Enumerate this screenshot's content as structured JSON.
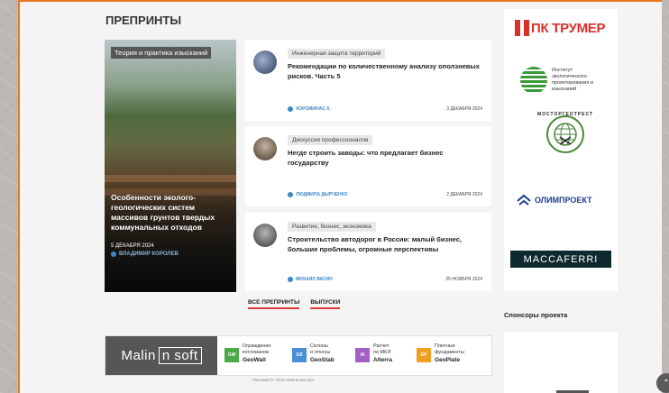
{
  "section": {
    "title": "ПРЕПРИНТЫ"
  },
  "featured": {
    "tag": "Теория и практика изысканий",
    "title": "Особенности эколого-геологических систем массивов грунтов твердых коммунальных отходов",
    "date": "5 ДЕКАБРЯ 2024",
    "author": "ВЛАДИМИР КОРОЛЕВ"
  },
  "articles": [
    {
      "tag": "Инженерная защита территорий",
      "title": "Рекомендации по количественному анализу оползневых рисков. Часть 5",
      "author": "ХОРОМИНАС Х.",
      "date": "3 ДЕКАБРЯ 2024",
      "thumb_color": "#5a6b8a"
    },
    {
      "tag": "Дискуссия профессионалов",
      "title": "Негде строить заводы: что предлагает бизнес государству",
      "author": "ЛЮДМИЛА ДЫРЧЕНКО",
      "date": "2 ДЕКАБРЯ 2024",
      "thumb_color": "#7a6a5a"
    },
    {
      "tag": "Развитие, бизнес, экономика",
      "title": "Строительство автодорог в России: малый бизнес, большие проблемы, огромные перспективы",
      "author": "МИХАИЛ ВАСИН",
      "date": "25 НОЯБРЯ 2024",
      "thumb_color": "#6a6a6a"
    }
  ],
  "links": {
    "all_preprints": "ВСЕ ПРЕПРИНТЫ",
    "issues": "ВЫПУСКИ"
  },
  "banner": {
    "brand_left": "Malin",
    "brand_right": "n soft",
    "products": [
      {
        "code": "GW",
        "line1": "Ограждение",
        "line2": "котлованов",
        "name": "GeoWall",
        "color": "#4aaa44"
      },
      {
        "code": "GS",
        "line1": "Склоны",
        "line2": "и откосы",
        "name": "GeoStab",
        "color": "#4a8fd6"
      },
      {
        "code": "AI",
        "line1": "Расчет",
        "line2": "по МКЭ",
        "name": "Alterra",
        "color": "#a25fc4"
      },
      {
        "code": "GP",
        "line1": "Плитные",
        "line2": "фундаменты",
        "name": "GeoPlate",
        "color": "#f0a020"
      }
    ],
    "ad_note": "Реклама 0+ ООО Инжгеоэксперт"
  },
  "sidebar": {
    "trumer": "ПК ТРУМЕР",
    "institute": "Институт экологического проектирования и изысканий",
    "mosto": "МОСТОРГЕОТРЕСТ",
    "olimp": "ОЛИМПРОЕКТ",
    "maccaferri": "MACCAFERRI"
  },
  "sponsors": {
    "title": "Спонсоры проекта"
  },
  "colors": {
    "accent": "#e87722",
    "link": "#3d86c6",
    "underline": "#e23b3b"
  }
}
